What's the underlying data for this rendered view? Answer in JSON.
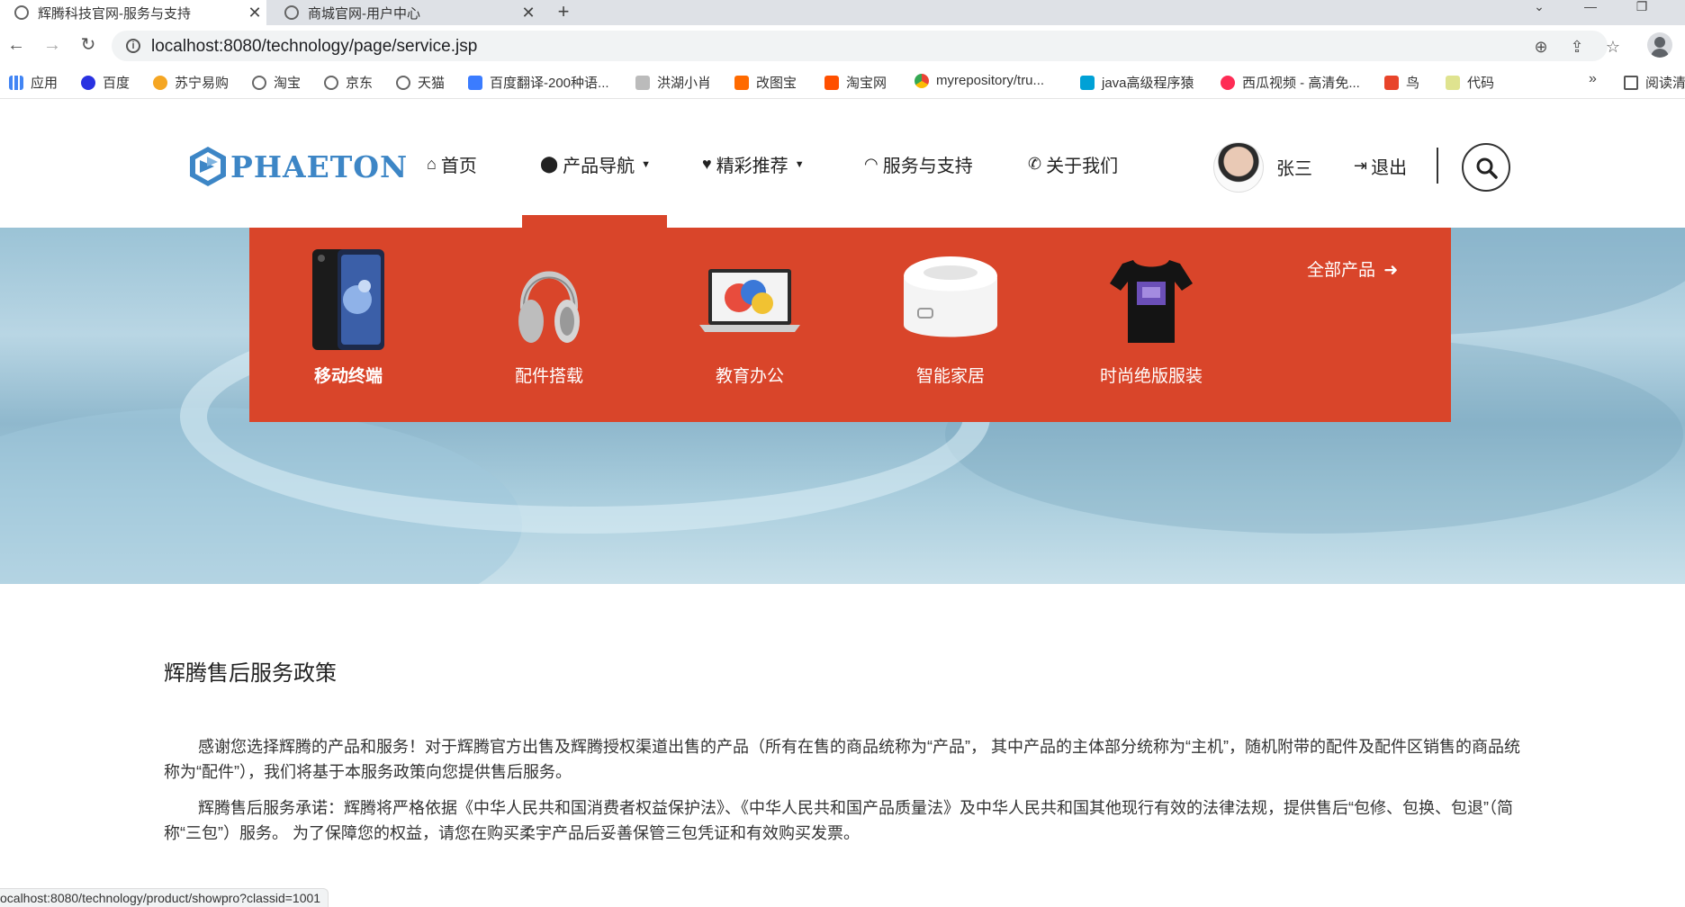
{
  "browser": {
    "tabs": [
      {
        "title": "辉腾科技官网-服务与支持",
        "active": true
      },
      {
        "title": "商城官网-用户中心",
        "active": false
      }
    ],
    "new_tab": "+",
    "url": "localhost:8080/technology/page/service.jsp",
    "status_url": "ocalhost:8080/technology/product/showpro?classid=1001",
    "bookmarks": [
      {
        "label": "应用",
        "icon": "apps-grid-icon",
        "color": "#4285f4"
      },
      {
        "label": "百度",
        "icon": "baidu-paw-icon",
        "color": "#2932e1"
      },
      {
        "label": "苏宁易购",
        "icon": "suning-icon",
        "color": "#f5a623"
      },
      {
        "label": "淘宝",
        "icon": "globe-icon",
        "color": "#666666"
      },
      {
        "label": "京东",
        "icon": "globe-icon",
        "color": "#666666"
      },
      {
        "label": "天猫",
        "icon": "globe-icon",
        "color": "#666666"
      },
      {
        "label": "百度翻译-200种语...",
        "icon": "translate-icon",
        "color": "#3b7cff"
      },
      {
        "label": "洪湖小肖",
        "icon": "bird-icon",
        "color": "#999999"
      },
      {
        "label": "改图宝",
        "icon": "gaitubao-icon",
        "color": "#ff6a00"
      },
      {
        "label": "淘宝网",
        "icon": "taobao-icon",
        "color": "#ff5000"
      },
      {
        "label": "myrepository/tru...",
        "icon": "chrome-icon",
        "color": "#34a853"
      },
      {
        "label": "java高级程序猿",
        "icon": "bilibili-icon",
        "color": "#00a1d6"
      },
      {
        "label": "西瓜视频 - 高清免...",
        "icon": "xigua-icon",
        "color": "#fe2c55"
      },
      {
        "label": "鸟",
        "icon": "bird-red-icon",
        "color": "#e8442a"
      },
      {
        "label": "代码",
        "icon": "code-icon",
        "color": "#c9d36a"
      }
    ],
    "bookmarks_more": "»",
    "reading_list": "阅读清"
  },
  "header": {
    "logo_text": "PHAETON",
    "nav": [
      {
        "label": "首页",
        "icon": "home-icon"
      },
      {
        "label": "产品导航",
        "icon": "map-marker-icon",
        "dropdown": true
      },
      {
        "label": "精彩推荐",
        "icon": "heart-icon",
        "dropdown": true
      },
      {
        "label": "服务与支持",
        "icon": "headphones-icon"
      },
      {
        "label": "关于我们",
        "icon": "phone-icon"
      }
    ],
    "username": "张三",
    "logout": "退出",
    "accent_color": "#d9452a"
  },
  "dropdown": {
    "items": [
      {
        "label": "移动终端",
        "thumb": "phone-thumb"
      },
      {
        "label": "配件搭载",
        "thumb": "headphones-thumb"
      },
      {
        "label": "教育办公",
        "thumb": "laptop-thumb"
      },
      {
        "label": "智能家居",
        "thumb": "rice-cooker-thumb"
      },
      {
        "label": "时尚绝版服装",
        "thumb": "tshirt-thumb"
      }
    ],
    "all_products": "全部产品"
  },
  "content": {
    "title": "辉腾售后服务政策",
    "paragraphs": [
      "感谢您选择辉腾的产品和服务！对于辉腾官方出售及辉腾授权渠道出售的产品（所有在售的商品统称为“产品”， 其中产品的主体部分统称为“主机”，随机附带的配件及配件区销售的商品统称为“配件”），我们将基于本服务政策向您提供售后服务。",
      "辉腾售后服务承诺：辉腾将严格依据《中华人民共和国消费者权益保护法》、《中华人民共和国产品质量法》及中华人民共和国其他现行有效的法律法规，提供售后“包修、包换、包退”（简称“三包”）服务。 为了保障您的权益，请您在购买柔宇产品后妥善保管三包凭证和有效购买发票。"
    ]
  }
}
